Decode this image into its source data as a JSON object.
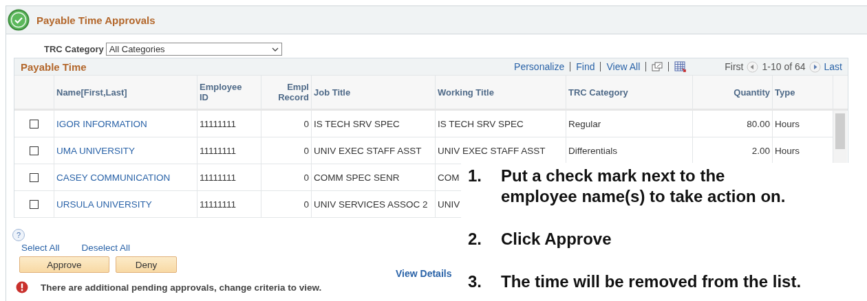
{
  "header": {
    "title": "Payable Time Approvals"
  },
  "filter": {
    "label": "TRC Category",
    "value": "All Categories"
  },
  "grid": {
    "title": "Payable Time",
    "tools": [
      "Personalize",
      "Find",
      "View All"
    ],
    "pager": {
      "first": "First",
      "range": "1-10 of 64",
      "last": "Last"
    },
    "columns": [
      "Name[First,Last]",
      "Employee ID",
      "Empl Record",
      "Job Title",
      "Working Title",
      "TRC Category",
      "Quantity",
      "Type"
    ],
    "rows": [
      {
        "checked": false,
        "cells": [
          "IGOR INFORMATION",
          "11111111",
          "0",
          "IS TECH SRV SPEC",
          "IS TECH SRV SPEC",
          "Regular",
          "80.00",
          "Hours"
        ]
      },
      {
        "checked": false,
        "cells": [
          "UMA UNIVERSITY",
          "11111111",
          "0",
          "UNIV EXEC STAFF ASST",
          "UNIV EXEC STAFF ASST",
          "Differentials",
          "2.00",
          "Hours"
        ]
      },
      {
        "checked": false,
        "cells": [
          "CASEY COMMUNICATION",
          "11111111",
          "0",
          "COMM SPEC SENR",
          "COM"
        ]
      },
      {
        "checked": false,
        "cells": [
          "URSULA UNIVERSITY",
          "11111111",
          "0",
          "UNIV SERVICES ASSOC 2",
          "UNIV"
        ]
      }
    ]
  },
  "help": "?",
  "select_all": "Select All",
  "deselect_all": "Deselect All",
  "buttons": [
    "Approve",
    "Deny"
  ],
  "view_details": "View Details",
  "message": "There are additional pending approvals, change criteria to view.",
  "instructions": [
    {
      "number": "1.",
      "text": "Put a check mark next to the employee name(s) to take action on."
    },
    {
      "number": "2.",
      "text": "Click Approve"
    },
    {
      "number": "3.",
      "text": "The time will be removed from the list."
    }
  ]
}
